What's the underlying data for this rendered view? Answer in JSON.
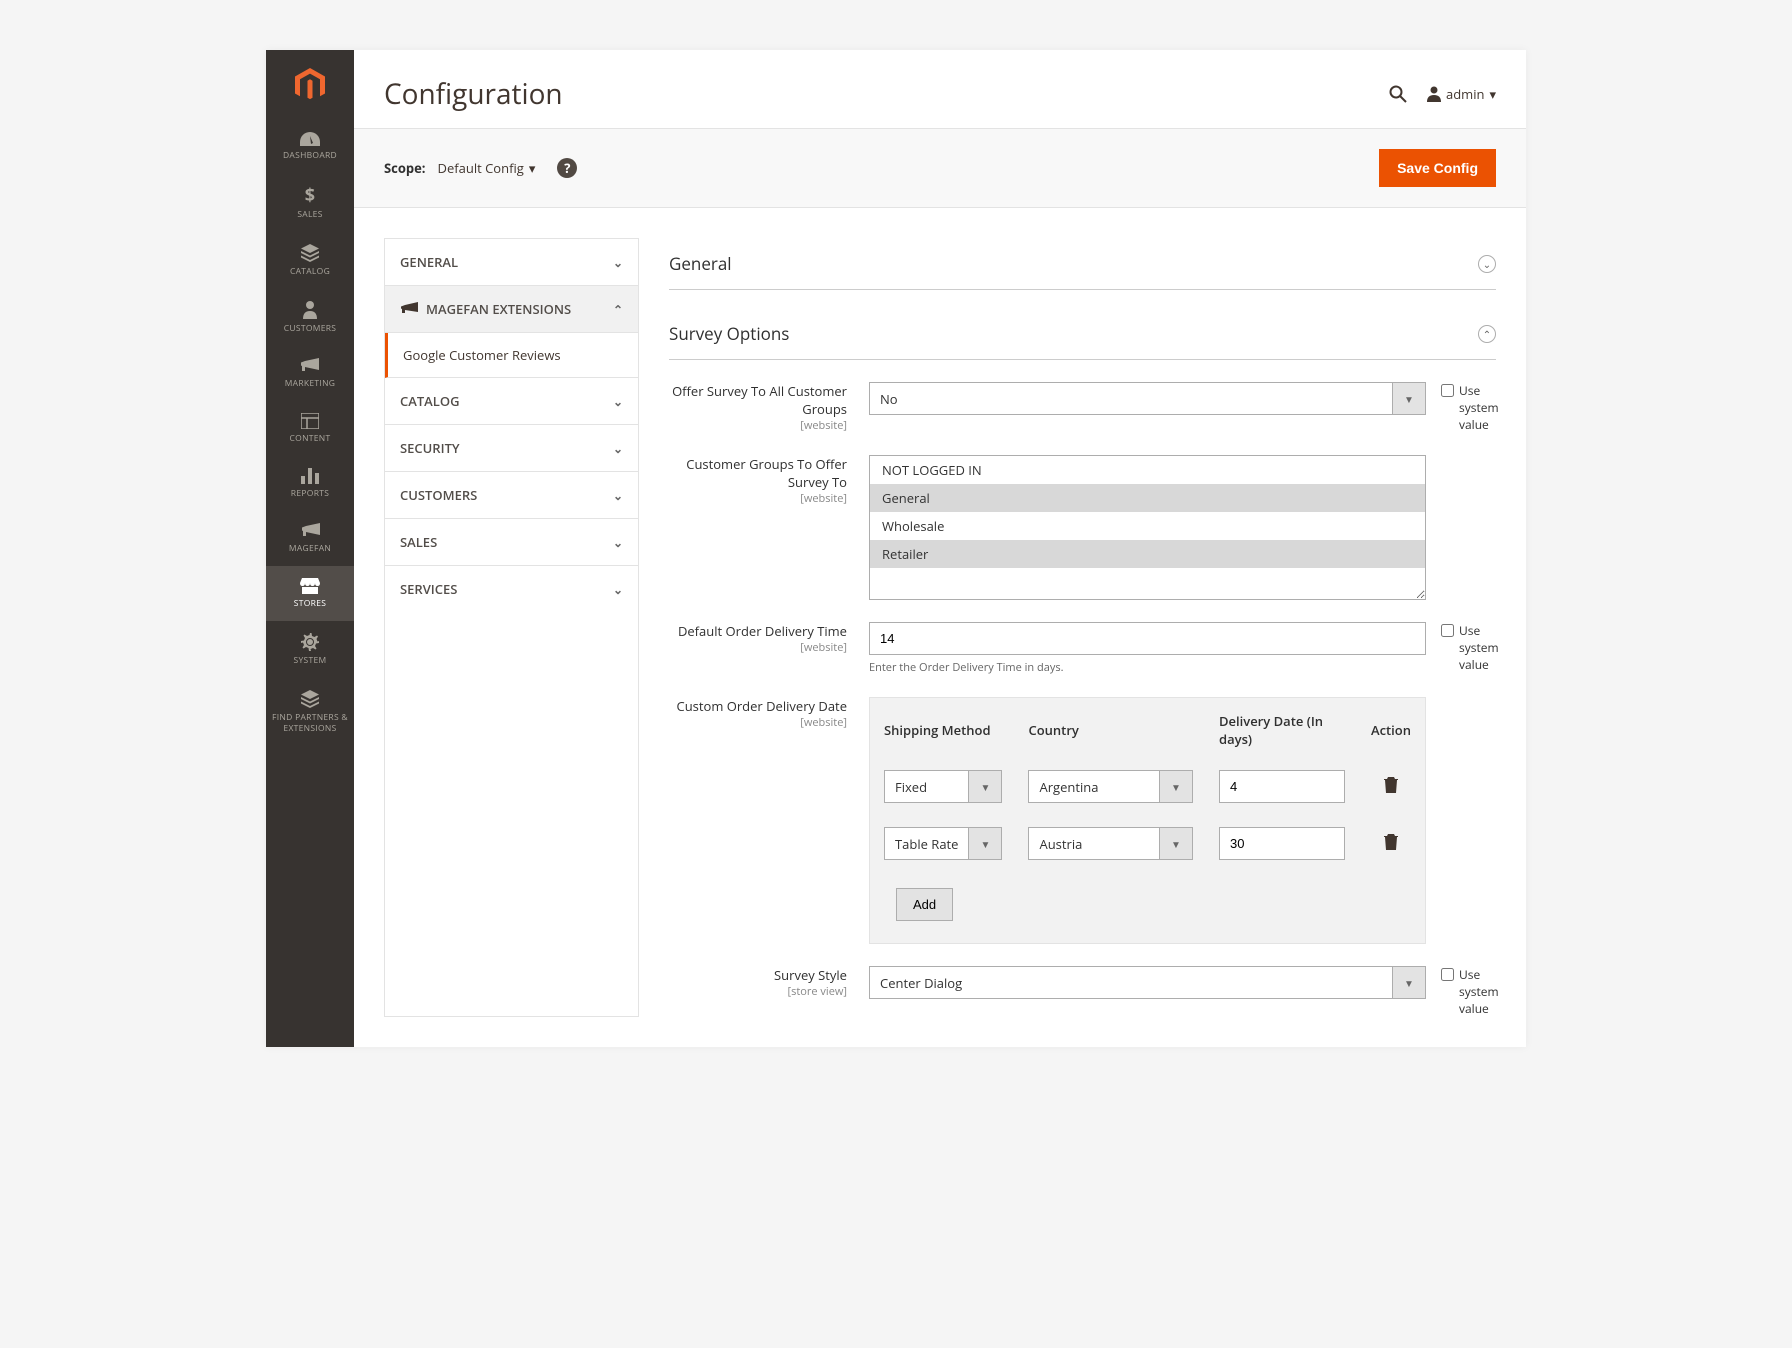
{
  "header": {
    "title": "Configuration",
    "user": "admin"
  },
  "scope_bar": {
    "label": "Scope:",
    "value": "Default Config",
    "save_button": "Save Config"
  },
  "sidebar": {
    "items": [
      {
        "label": "DASHBOARD"
      },
      {
        "label": "SALES"
      },
      {
        "label": "CATALOG"
      },
      {
        "label": "CUSTOMERS"
      },
      {
        "label": "MARKETING"
      },
      {
        "label": "CONTENT"
      },
      {
        "label": "REPORTS"
      },
      {
        "label": "MAGEFAN"
      },
      {
        "label": "STORES"
      },
      {
        "label": "SYSTEM"
      },
      {
        "label": "FIND PARTNERS & EXTENSIONS"
      }
    ]
  },
  "config_tabs": {
    "general": "GENERAL",
    "magefan": "MAGEFAN EXTENSIONS",
    "google_reviews": "Google Customer Reviews",
    "catalog": "CATALOG",
    "security": "SECURITY",
    "customers": "CUSTOMERS",
    "sales": "SALES",
    "services": "SERVICES"
  },
  "sections": {
    "general": "General",
    "survey_options": "Survey Options"
  },
  "fields": {
    "offer_all": {
      "label": "Offer Survey To All Customer Groups",
      "scope": "[website]",
      "value": "No",
      "sys": "Use system value"
    },
    "groups": {
      "label": "Customer Groups To Offer Survey To",
      "scope": "[website]",
      "options": [
        "NOT LOGGED IN",
        "General",
        "Wholesale",
        "Retailer"
      ]
    },
    "delivery_time": {
      "label": "Default Order Delivery Time",
      "scope": "[website]",
      "value": "14",
      "note": "Enter the Order Delivery Time in days.",
      "sys": "Use system value"
    },
    "custom_date": {
      "label": "Custom Order Delivery Date",
      "scope": "[website]",
      "headers": {
        "method": "Shipping Method",
        "country": "Country",
        "days": "Delivery Date (In days)",
        "action": "Action"
      },
      "rows": [
        {
          "method": "Fixed",
          "country": "Argentina",
          "days": "4"
        },
        {
          "method": "Table Rate",
          "country": "Austria",
          "days": "30"
        }
      ],
      "add_btn": "Add"
    },
    "survey_style": {
      "label": "Survey Style",
      "scope": "[store view]",
      "value": "Center Dialog",
      "sys": "Use system value"
    }
  }
}
